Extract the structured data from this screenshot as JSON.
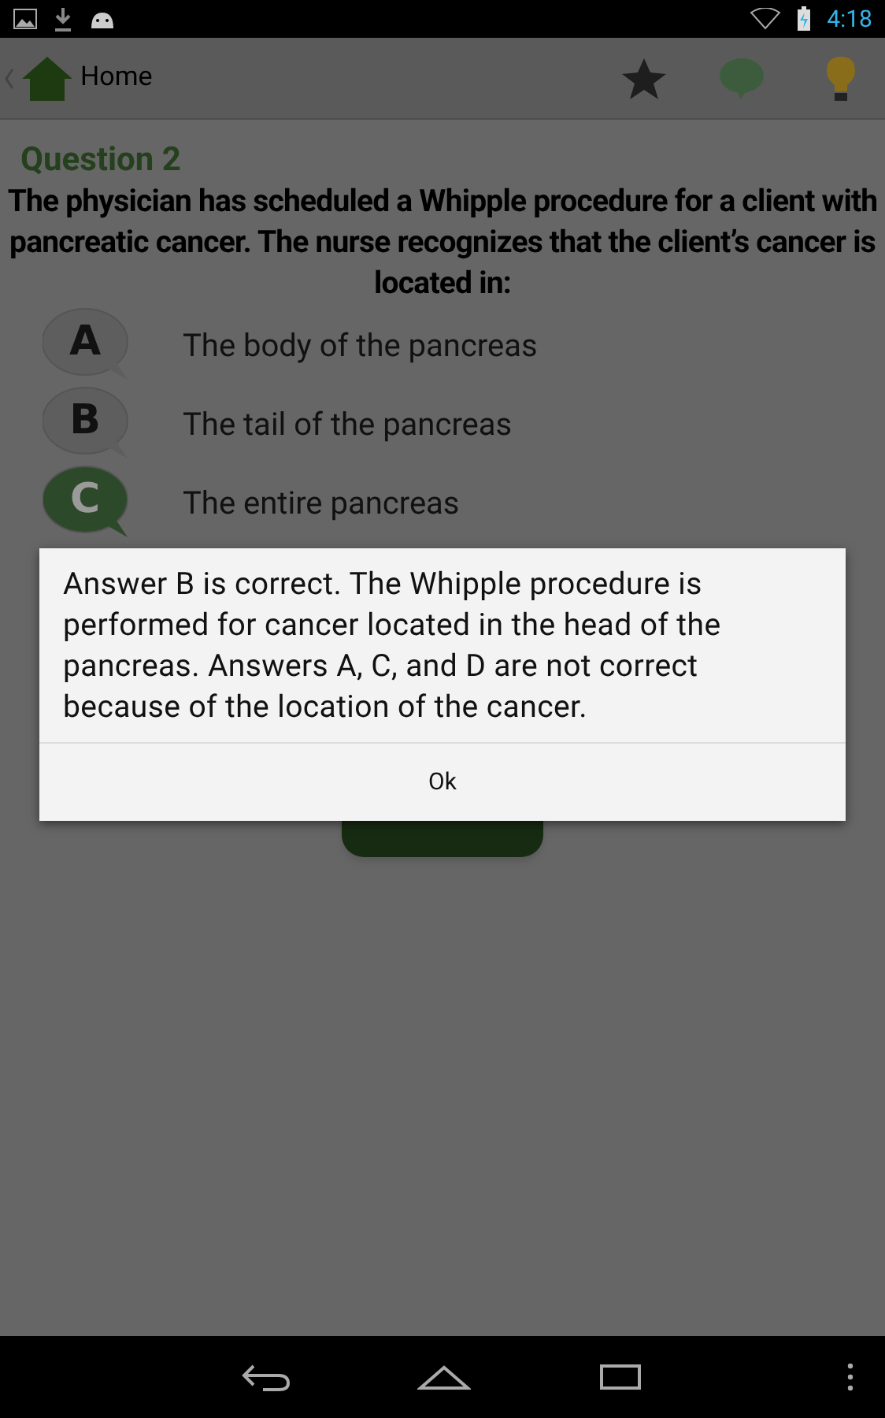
{
  "status_bar": {
    "time": "4:18"
  },
  "action_bar": {
    "title": "Home"
  },
  "question": {
    "heading": "Question 2",
    "text": "The physician has scheduled a Whipple procedure for a client with pancreatic cancer. The nurse recognizes that the client’s cancer is located in:"
  },
  "options": [
    {
      "letter": "A",
      "text": "The body of the pancreas",
      "selected": false
    },
    {
      "letter": "B",
      "text": "The tail of the pancreas",
      "selected": false
    },
    {
      "letter": "C",
      "text": "The entire pancreas",
      "selected": true
    }
  ],
  "dialog": {
    "message": "Answer B is correct. The Whipple procedure is performed for cancer located in the head of the pancreas. Answers A, C, and D are not correct because of the location of the cancer.",
    "button": "Ok"
  }
}
